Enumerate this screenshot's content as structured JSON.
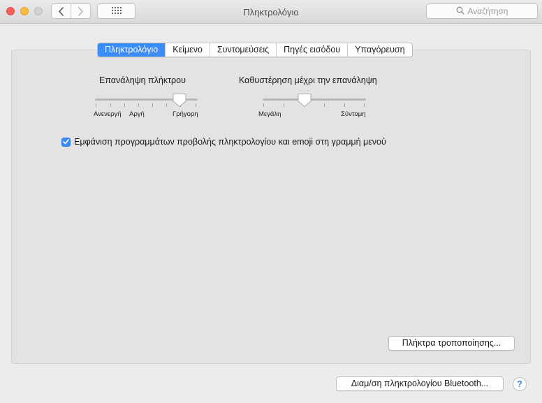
{
  "window": {
    "title": "Πληκτρολόγιο",
    "controls": [
      "close",
      "minimize",
      "zoom"
    ]
  },
  "toolbar": {
    "back_icon": "chevron-left-icon",
    "forward_icon": "chevron-right-icon",
    "grid_icon": "grid-icon",
    "search_placeholder": "Αναζήτηση",
    "search_icon": "search-icon"
  },
  "tabs": [
    {
      "label": "Πληκτρολόγιο",
      "selected": true
    },
    {
      "label": "Κείμενο",
      "selected": false
    },
    {
      "label": "Συντομεύσεις",
      "selected": false
    },
    {
      "label": "Πηγές εισόδου",
      "selected": false
    },
    {
      "label": "Υπαγόρευση",
      "selected": false
    }
  ],
  "key_repeat": {
    "title": "Επανάληψη πλήκτρου",
    "labels": {
      "off": "Ανενεργή",
      "slow": "Αργή",
      "fast": "Γρήγορη"
    },
    "value_fraction": 0.83
  },
  "delay_until_repeat": {
    "title": "Καθυστέρηση μέχρι την επανάληψη",
    "labels": {
      "long": "Μεγάλη",
      "short": "Σύντομη"
    },
    "value_fraction": 0.4
  },
  "show_viewers_checkbox": {
    "label": "Εμφάνιση προγραμμάτων προβολής πληκτρολογίου και emoji στη γραμμή μενού",
    "checked": true
  },
  "modifier_keys_button": {
    "label": "Πλήκτρα τροποποίησης..."
  },
  "bluetooth_button": {
    "label": "Διαμ/ση πληκτρολογίου Bluetooth..."
  },
  "help_button": {
    "label": "?"
  },
  "colors": {
    "accent": "#3a8df8",
    "close": "#fc605c",
    "minimize": "#fdbc40",
    "zoom_inactive": "#d3d3d3"
  }
}
